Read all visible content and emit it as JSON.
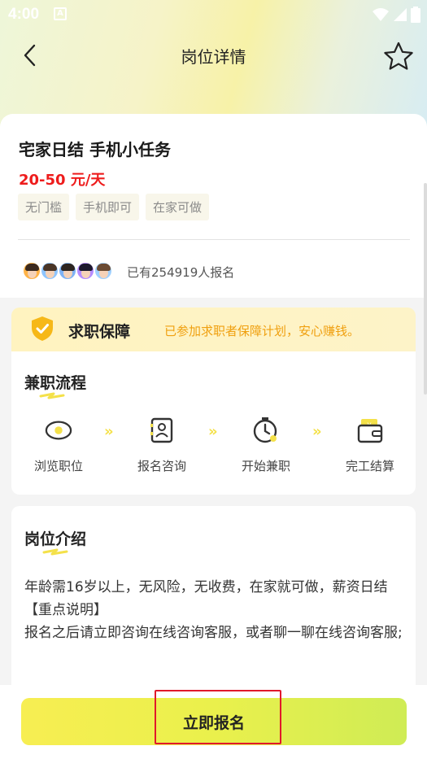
{
  "status_bar": {
    "time": "4:00",
    "notification_letter": "A"
  },
  "nav": {
    "title": "岗位详情"
  },
  "job": {
    "title": "宅家日结 手机小任务",
    "salary": "20-50 元/天",
    "tags": [
      "无门槛",
      "手机即可",
      "在家可做"
    ],
    "signup_text": "已有254919人报名"
  },
  "guarantee": {
    "title": "求职保障",
    "description": "已参加求职者保障计划，安心赚钱。"
  },
  "process": {
    "title": "兼职流程",
    "steps": [
      "浏览职位",
      "报名咨询",
      "开始兼职",
      "完工结算"
    ],
    "separator": "»"
  },
  "intro": {
    "title": "岗位介绍",
    "lines": [
      "年龄需16岁以上，无风险，无收费，在家就可做，薪资日结",
      "【重点说明】",
      "报名之后请立即咨询在线咨询客服，或者聊一聊在线咨询客服;"
    ]
  },
  "apply": {
    "label": "立即报名"
  },
  "colors": {
    "salary": "#ee1c1c",
    "accent_yellow": "#f4e14a",
    "guarantee_text": "#f0a010",
    "highlight_box": "#e0192b"
  }
}
